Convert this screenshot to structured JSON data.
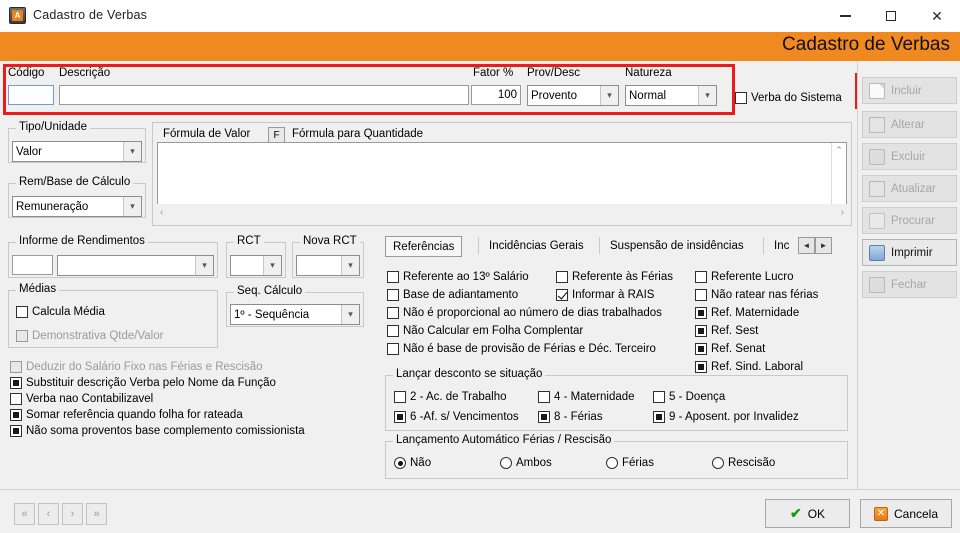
{
  "window": {
    "title": "Cadastro de Verbas",
    "icon": "app-icon",
    "minimize": "–",
    "maximize": "□",
    "close": "✕"
  },
  "banner": {
    "title": "Cadastro de Verbas",
    "color": "#f0891f"
  },
  "highlight_color": "#ee1b1b",
  "header": {
    "codigo_label": "Código",
    "codigo_value": "",
    "descricao_label": "Descrição",
    "descricao_value": "",
    "fator_label": "Fator %",
    "fator_value": "100",
    "prov_desc_label": "Prov/Desc",
    "prov_desc_value": "Provento",
    "natureza_label": "Natureza",
    "natureza_value": "Normal",
    "verba_sistema_label": "Verba do Sistema",
    "verba_sistema_checked": false
  },
  "left": {
    "tipo_unidade_label": "Tipo/Unidade",
    "tipo_unidade_value": "Valor",
    "rem_base_label": "Rem/Base de Cálculo",
    "rem_base_value": "Remuneração",
    "informe_label": "Informe de Rendimentos",
    "informe_code": "",
    "informe_value": "",
    "rct_label": "RCT",
    "rct_value": "",
    "nova_rct_label": "Nova RCT",
    "nova_rct_value": "",
    "medias_label": "Médias",
    "calcula_media_label": "Calcula Média",
    "demonstrativa_label": "Demonstrativa Qtde/Valor",
    "seq_calculo_label": "Seq. Cálculo",
    "seq_calculo_value": "1º - Sequência",
    "options": [
      {
        "label": "Deduzir do Salário Fixo nas  Férias e Rescisão",
        "state": "disabled"
      },
      {
        "label": "Substituir descrição Verba pelo Nome da Função",
        "state": "filled"
      },
      {
        "label": "Verba nao Contabilizavel",
        "state": "unchecked"
      },
      {
        "label": "Somar referência quando folha for rateada",
        "state": "filled"
      },
      {
        "label": "Não soma proventos base complemento comissionista",
        "state": "filled"
      }
    ]
  },
  "formula": {
    "valor_tab": "Fórmula de Valor",
    "f_button": "F",
    "quantidade_tab": "Fórmula para Quantidade",
    "text": "",
    "scroll_up": "⌃",
    "scroll_down": "⌄",
    "scroll_left": "‹",
    "scroll_right": "›"
  },
  "tabs": {
    "items": [
      {
        "label": "Referências",
        "active": true
      },
      {
        "label": "Incidências Gerais",
        "active": false
      },
      {
        "label": "Suspensão de insidências",
        "active": false
      },
      {
        "label": "Inc",
        "active": false
      }
    ],
    "nav_prev": "◄",
    "nav_next": "►"
  },
  "referencias": {
    "col1": [
      {
        "label": "Referente ao 13º Salário",
        "state": "unchecked"
      },
      {
        "label": "Base de adiantamento",
        "state": "unchecked"
      },
      {
        "label": "Não é proporcional ao número de dias trabalhados",
        "state": "unchecked"
      },
      {
        "label": "Não Calcular em Folha Complentar",
        "state": "unchecked"
      },
      {
        "label": "Não é base de provisão de Férias e Déc. Terceiro",
        "state": "unchecked"
      }
    ],
    "col2": [
      {
        "label": "Referente às Férias",
        "state": "unchecked"
      },
      {
        "label": "Informar à RAIS",
        "state": "checked"
      }
    ],
    "col3": [
      {
        "label": "Referente Lucro",
        "state": "unchecked"
      },
      {
        "label": "Não ratear nas férias",
        "state": "unchecked"
      },
      {
        "label": "Ref. Maternidade",
        "state": "filled"
      },
      {
        "label": "Ref. Sest",
        "state": "filled"
      },
      {
        "label": "Ref. Senat",
        "state": "filled"
      },
      {
        "label": "Ref. Sind. Laboral",
        "state": "filled"
      }
    ]
  },
  "lancar_desconto": {
    "title": "Lançar desconto se situação",
    "items": [
      {
        "label": "2 - Ac. de Trabalho",
        "state": "unchecked"
      },
      {
        "label": "4 - Maternidade",
        "state": "unchecked"
      },
      {
        "label": "5 - Doença",
        "state": "unchecked"
      },
      {
        "label": "6 -Af. s/ Vencimentos",
        "state": "filled"
      },
      {
        "label": "8 - Férias",
        "state": "filled"
      },
      {
        "label": "9 - Aposent. por Invalidez",
        "state": "filled"
      }
    ]
  },
  "lancamento_auto": {
    "title": "Lançamento Automático Férias / Rescisão",
    "options": [
      {
        "label": "Não",
        "selected": true
      },
      {
        "label": "Ambos",
        "selected": false
      },
      {
        "label": "Férias",
        "selected": false
      },
      {
        "label": "Rescisão",
        "selected": false
      }
    ]
  },
  "sidebar": {
    "buttons": [
      {
        "label": "Incluir",
        "icon": "paper-icon",
        "enabled": false,
        "highlighted": true
      },
      {
        "label": "Alterar",
        "icon": "pencil-icon",
        "enabled": false,
        "highlighted": false
      },
      {
        "label": "Excluir",
        "icon": "trash-icon",
        "enabled": false,
        "highlighted": false
      },
      {
        "label": "Atualizar",
        "icon": "refresh-icon",
        "enabled": false,
        "highlighted": false
      },
      {
        "label": "Procurar",
        "icon": "binoculars-icon",
        "enabled": false,
        "highlighted": false
      },
      {
        "label": "Imprimir",
        "icon": "printer-icon",
        "enabled": true,
        "highlighted": false
      },
      {
        "label": "Fechar",
        "icon": "exit-icon",
        "enabled": false,
        "highlighted": false
      }
    ]
  },
  "footer": {
    "nav": [
      {
        "label": "«",
        "name": "first"
      },
      {
        "label": "‹",
        "name": "prev"
      },
      {
        "label": "›",
        "name": "next"
      },
      {
        "label": "»",
        "name": "last"
      }
    ],
    "ok_label": "OK",
    "ok_icon": "✔",
    "cancel_label": "Cancela",
    "cancel_icon": "✕"
  }
}
